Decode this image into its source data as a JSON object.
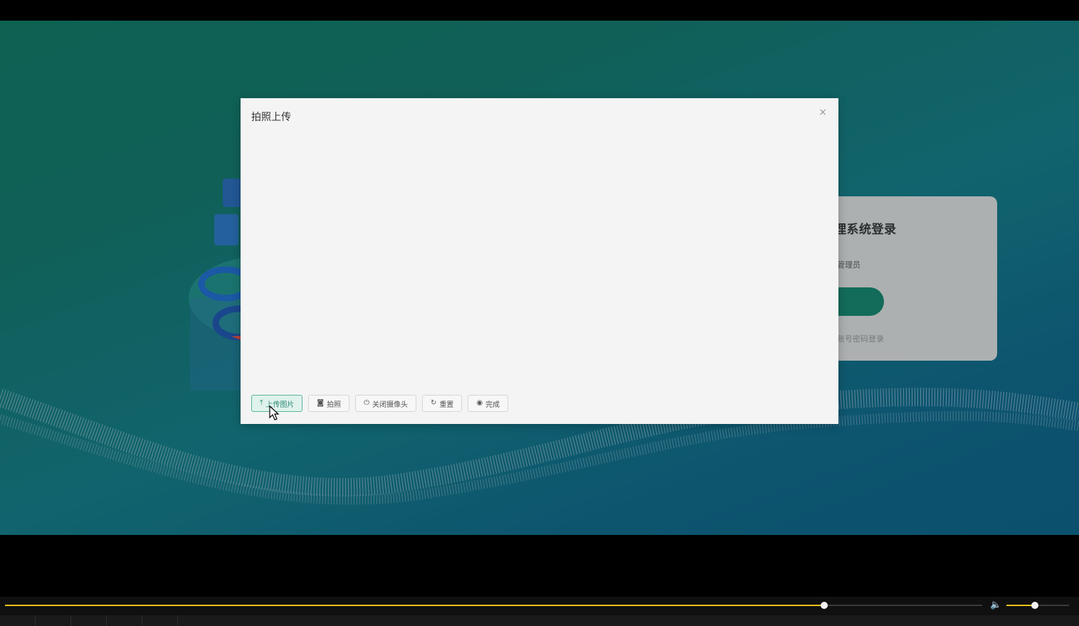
{
  "modal": {
    "title": "拍照上传",
    "close_glyph": "×",
    "buttons": [
      {
        "label": "上传图片",
        "icon": "upload-icon",
        "glyph": "⤒"
      },
      {
        "label": "拍照",
        "icon": "camera-icon",
        "glyph": "◙"
      },
      {
        "label": "关闭摄像头",
        "icon": "power-icon",
        "glyph": "⏻"
      },
      {
        "label": "重置",
        "icon": "refresh-icon",
        "glyph": "↻"
      },
      {
        "label": "完成",
        "icon": "check-circle-icon",
        "glyph": "◉"
      }
    ]
  },
  "login": {
    "title_partial": "理系统登录",
    "role_partial": "管理员",
    "alt_login_partial": "账号密码登录"
  },
  "player": {
    "progress_fraction": 0.838,
    "volume_fraction": 0.45,
    "volume_glyph": "🔈"
  },
  "colors": {
    "accent": "#e8c21a",
    "primary_button_text": "#2e8a75",
    "login_button": "#167a64"
  }
}
